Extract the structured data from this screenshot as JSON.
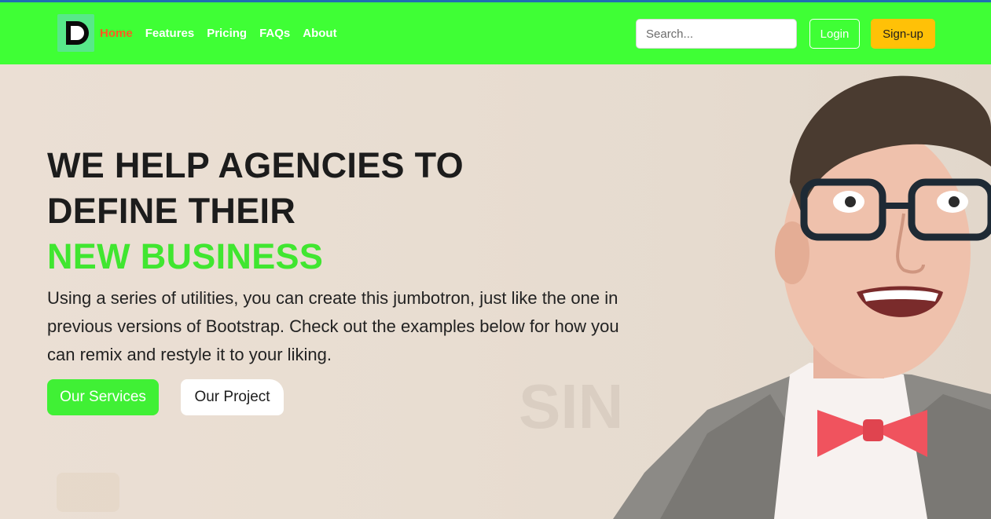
{
  "navbar": {
    "logo_alt": "logo",
    "links": [
      {
        "label": "Home"
      },
      {
        "label": "Features"
      },
      {
        "label": "Pricing"
      },
      {
        "label": "FAQs"
      },
      {
        "label": "About"
      }
    ],
    "active_link": "Home",
    "search_placeholder": "Search...",
    "login_label": "Login",
    "signup_label": "Sign-up"
  },
  "hero": {
    "title_line1": "WE HELP AGENCIES TO",
    "title_line2": "DEFINE THEIR",
    "title_accent": "NEW BUSINESS",
    "description": "Using a series of utilities, you can create this jumbotron, just like the one in previous versions of Bootstrap. Check out the examples below for how you can remix and restyle it to your liking.",
    "primary_button": "Our Services",
    "secondary_button": "Our Project"
  },
  "colors": {
    "nav_bg": "#3fff35",
    "accent_green": "#40e630",
    "active_link": "#ff5a1f",
    "signup_bg": "#ffc107"
  },
  "icons": {
    "logo": "logo-icon"
  }
}
